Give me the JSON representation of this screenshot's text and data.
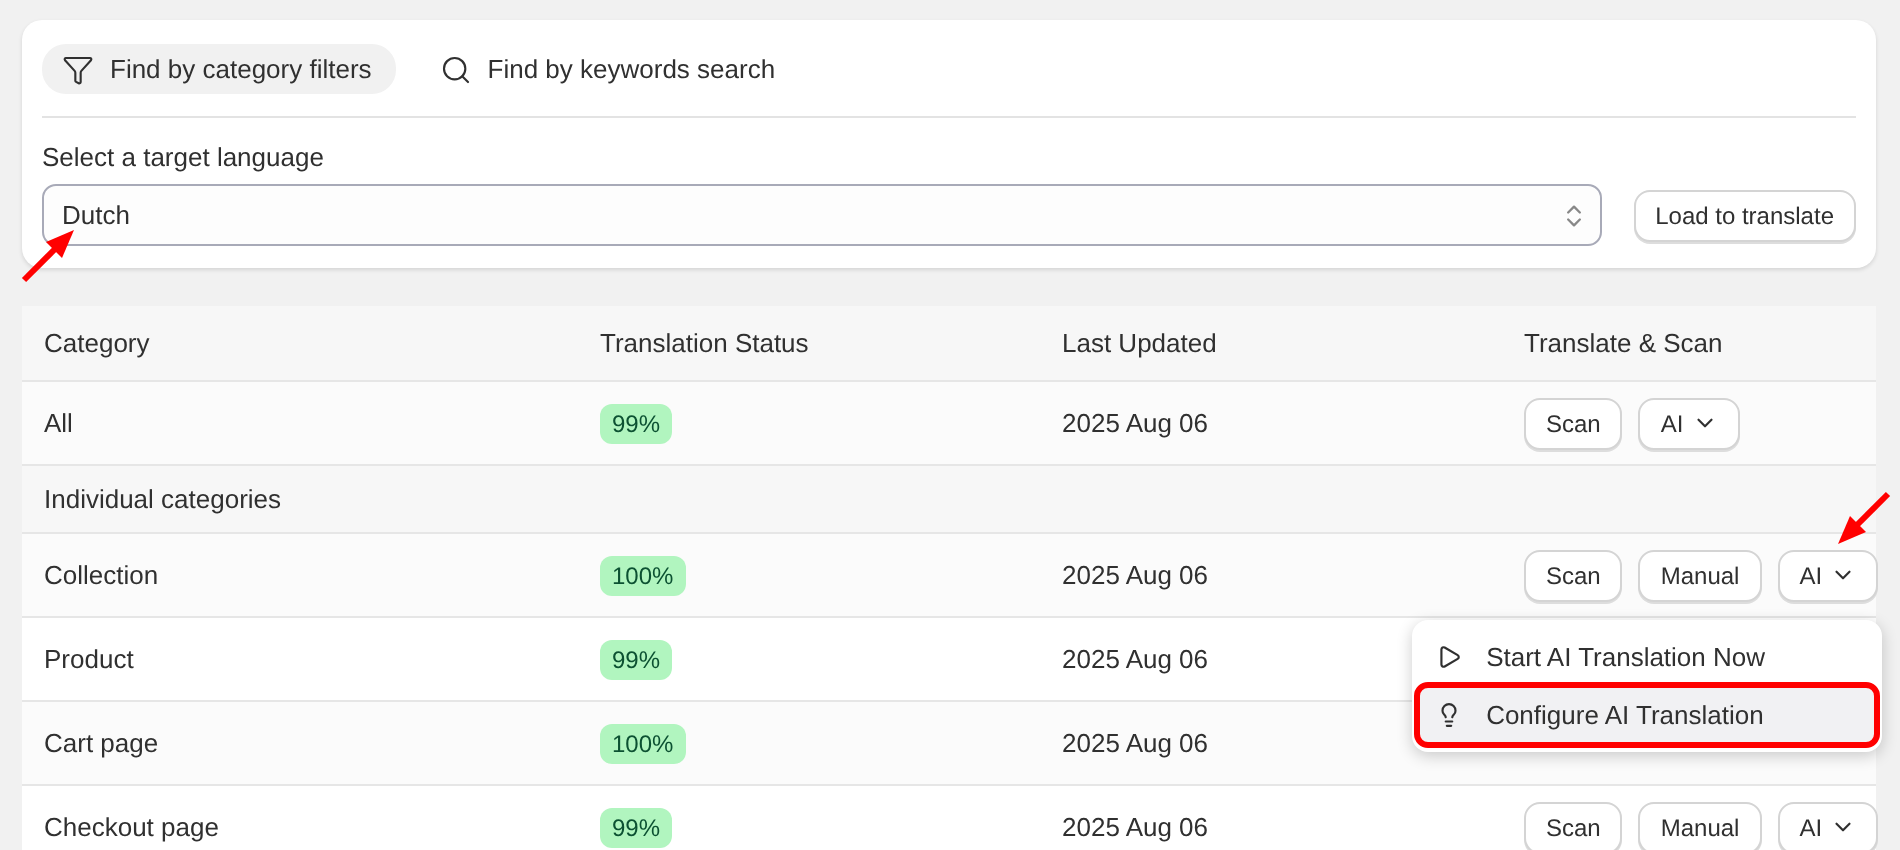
{
  "filter_tabs": [
    {
      "label": "Find by category filters",
      "selected": true
    },
    {
      "label": "Find by keywords search",
      "selected": false
    }
  ],
  "language": {
    "label": "Select a target language",
    "value": "Dutch",
    "pointed": true
  },
  "load_button": "Load to translate",
  "table": {
    "columns": [
      "Category",
      "Translation Status",
      "Last Updated",
      "Translate & Scan"
    ],
    "rows": [
      {
        "kind": "item",
        "category": "All",
        "status": "99%",
        "updated": "2025 Aug 06",
        "actions": [
          {
            "label": "Scan"
          },
          {
            "label": "AI",
            "dropdown": true
          }
        ]
      },
      {
        "kind": "section",
        "category": "Individual categories"
      },
      {
        "kind": "item",
        "category": "Collection",
        "status": "100%",
        "updated": "2025 Aug 06",
        "actions": [
          {
            "label": "Scan"
          },
          {
            "label": "Manual"
          },
          {
            "label": "AI",
            "dropdown": true,
            "pointed": true,
            "menu": [
              {
                "label": "Start AI Translation Now",
                "highlighted": false
              },
              {
                "label": "Configure AI Translation",
                "highlighted": true
              }
            ]
          }
        ]
      },
      {
        "kind": "item",
        "category": "Product",
        "status": "99%",
        "updated": "2025 Aug 06"
      },
      {
        "kind": "item",
        "category": "Cart page",
        "status": "100%",
        "updated": "2025 Aug 06"
      },
      {
        "kind": "item",
        "category": "Checkout page",
        "status": "99%",
        "updated": "2025 Aug 06",
        "actions": [
          {
            "label": "Scan"
          },
          {
            "label": "Manual"
          },
          {
            "label": "AI",
            "dropdown": true
          }
        ]
      }
    ]
  }
}
